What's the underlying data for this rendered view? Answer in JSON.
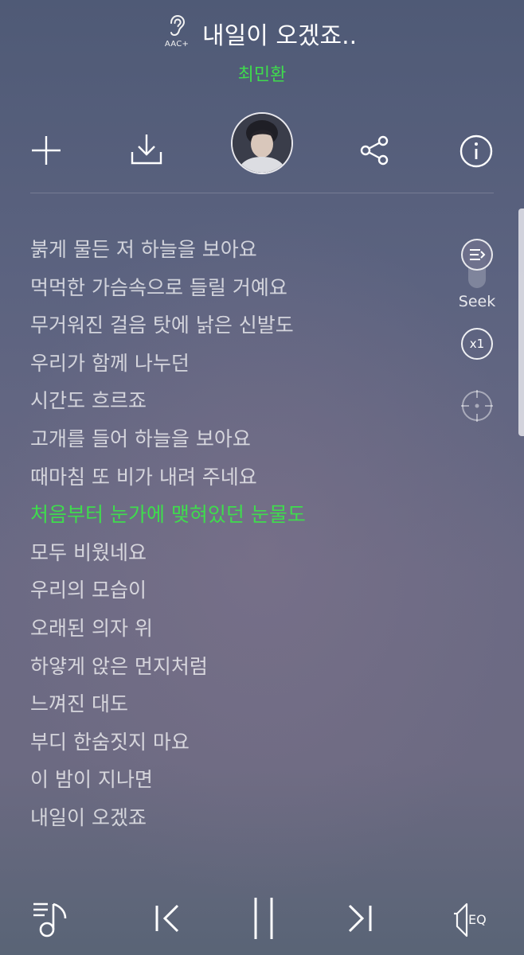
{
  "header": {
    "codec_badge": "AAC+",
    "title": "내일이 오겠죠..",
    "artist": "최민환"
  },
  "actions": {
    "add_icon": "plus-icon",
    "download_icon": "download-icon",
    "share_icon": "share-icon",
    "info_icon": "info-icon"
  },
  "lyrics": [
    "붉게 물든 저 하늘을 보아요",
    "먹먹한 가슴속으로 들릴 거예요",
    "무거워진 걸음 탓에 낡은 신발도",
    "우리가 함께 나누던",
    "시간도 흐르죠",
    "고개를 들어 하늘을 보아요",
    "때마침 또 비가 내려 주네요",
    "처음부터 눈가에 맺혀있던 눈물도",
    "모두 비웠네요",
    "우리의 모습이",
    "오래된 의자 위",
    "하얗게 앉은 먼지처럼",
    "느껴진 대도",
    "부디 한숨짓지 마요",
    "이 밤이 지나면",
    "내일이 오겠죠"
  ],
  "active_lyric_index": 7,
  "side_controls": {
    "seek_label": "Seek",
    "speed_label": "x1"
  },
  "playback": {
    "eq_label": "EQ",
    "state": "playing"
  },
  "colors": {
    "accent": "#3fdc4d",
    "text": "#ffffff",
    "lyric_inactive": "rgba(255,255,255,0.72)"
  }
}
